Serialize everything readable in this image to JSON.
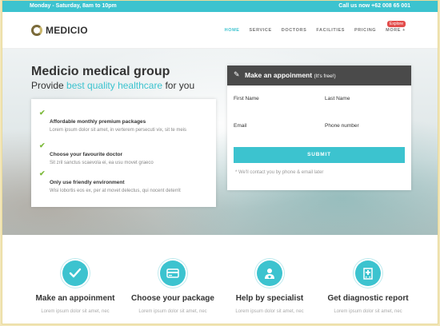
{
  "topbar": {
    "hours": "Monday - Saturday, 8am to 10pm",
    "phone": "Call us now +62 008 65 001"
  },
  "brand": {
    "name": "MEDICIO"
  },
  "nav": {
    "items": [
      "HOME",
      "SERVICE",
      "DOCTORS",
      "FACILITIES",
      "PRICING",
      "MORE +"
    ],
    "badge": "Explore"
  },
  "hero": {
    "title": "Medicio medical group",
    "subtitle_pre": "Provide ",
    "subtitle_accent": "best quality healthcare",
    "subtitle_post": " for you"
  },
  "features": [
    {
      "title": "Affordable monthly premium packages",
      "desc": "Lorem ipsum dolor sit amet, in verterem persecuti vix, sit te meis"
    },
    {
      "title": "Choose your favourite doctor",
      "desc": "Sit zril sanctus scaevola ei, ea usu movet graeco"
    },
    {
      "title": "Only use friendly environment",
      "desc": "Wisi lobortis eos ex, per at movet delectus, qui nocent deterrit"
    }
  ],
  "appointment": {
    "title": "Make an appoinment",
    "title_note": "(It's free!)",
    "first_name": "First Name",
    "last_name": "Last Name",
    "email": "Email",
    "phone": "Phone number",
    "submit": "SUBMIT",
    "note": "* We'll contact you by phone & email later"
  },
  "services": [
    {
      "icon": "checkmark-icon",
      "title": "Make an appoinment",
      "desc": "Lorem ipsum dolor sit amet, nec"
    },
    {
      "icon": "credit-card-icon",
      "title": "Choose your package",
      "desc": "Lorem ipsum dolor sit amet, nec"
    },
    {
      "icon": "doctor-icon",
      "title": "Help by specialist",
      "desc": "Lorem ipsum dolor sit amet, nec"
    },
    {
      "icon": "hospital-icon",
      "title": "Get diagnostic report",
      "desc": "Lorem ipsum dolor sit amet, nec"
    }
  ],
  "colors": {
    "accent": "#3cc3cf",
    "dark_header": "#4a4a4a",
    "check_green": "#7dba3b",
    "badge_red": "#e24c4b"
  }
}
